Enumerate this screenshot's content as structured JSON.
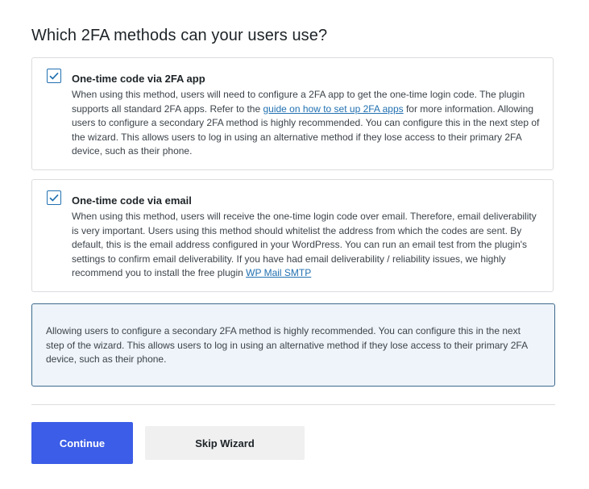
{
  "title": "Which 2FA methods can your users use?",
  "methods": [
    {
      "title": "One-time code via 2FA app",
      "checked": true,
      "desc_before": "When using this method, users will need to configure a 2FA app to get the one-time login code. The plugin supports all standard 2FA apps. Refer to the ",
      "link_text": "guide on how to set up 2FA apps",
      "desc_after": " for more information. Allowing users to configure a secondary 2FA method is highly recommended. You can configure this in the next step of the wizard. This allows users to log in using an alternative method if they lose access to their primary 2FA device, such as their phone."
    },
    {
      "title": "One-time code via email",
      "checked": true,
      "desc_before": "When using this method, users will receive the one-time login code over email. Therefore, email deliverability is very important. Users using this method should whitelist the address from which the codes are sent. By default, this is the email address configured in your WordPress. You can run an email test from the plugin's settings to confirm email deliverability. If you have had email deliverability / reliability issues, we highly recommend you to install the free plugin ",
      "link_text": "WP Mail SMTP",
      "desc_after": ""
    }
  ],
  "info": "Allowing users to configure a secondary 2FA method is highly recommended. You can configure this in the next step of the wizard. This allows users to log in using an alternative method if they lose access to their primary 2FA device, such as their phone.",
  "buttons": {
    "continue": "Continue",
    "skip": "Skip Wizard"
  },
  "colors": {
    "primary": "#3b5de7",
    "link": "#2271b1",
    "info_bg": "#eef4f9",
    "info_border": "#3d6a8e"
  },
  "icons": {
    "checkbox": "checkmark-icon"
  }
}
